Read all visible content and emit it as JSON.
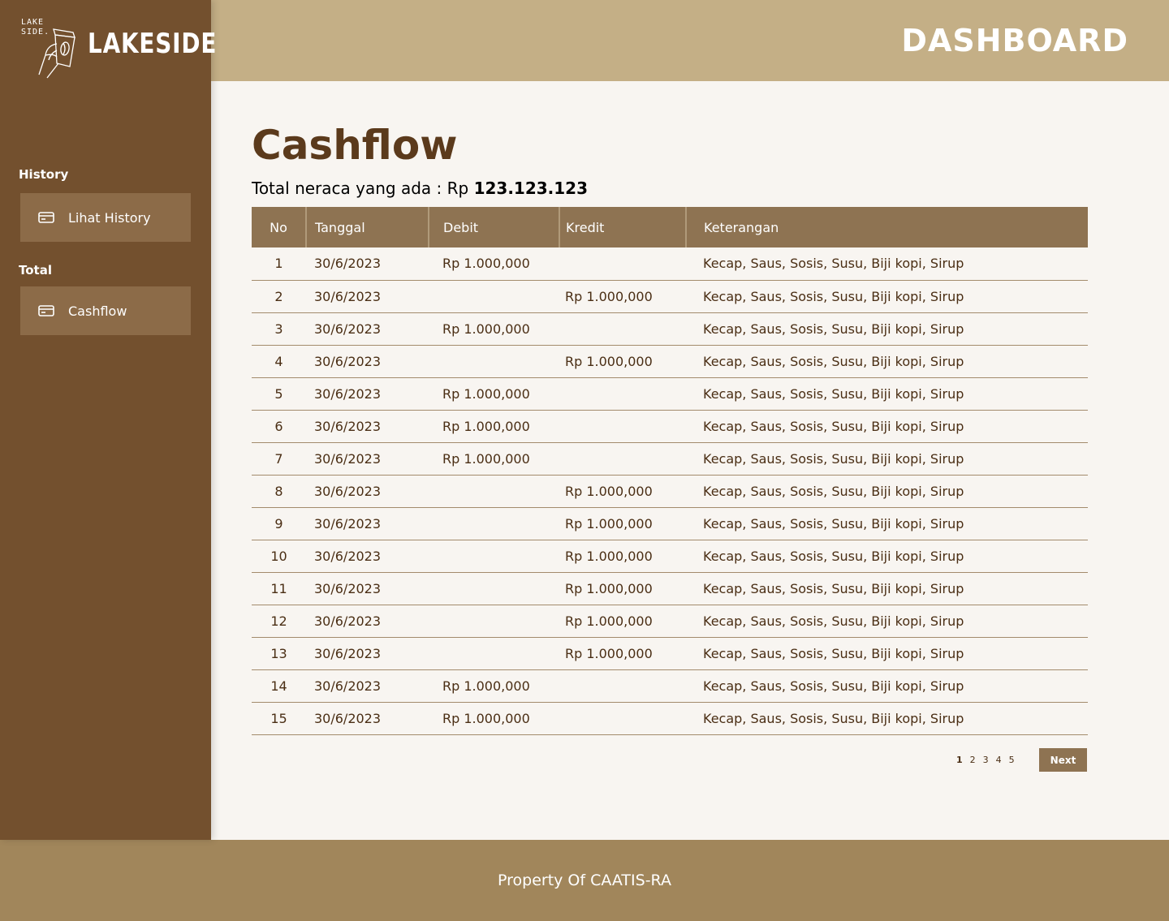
{
  "brand": {
    "small_text": "LAKE\nSIDE.",
    "name": "LAKESIDE"
  },
  "header": {
    "title": "DASHBOARD"
  },
  "sidebar": {
    "sections": [
      {
        "title": "History",
        "button": {
          "label": "Lihat History",
          "icon": "card-icon"
        }
      },
      {
        "title": "Total",
        "button": {
          "label": "Cashflow",
          "icon": "card-icon"
        }
      }
    ]
  },
  "main": {
    "title": "Cashflow",
    "total_label": "Total neraca yang ada : Rp ",
    "total_value": "123.123.123"
  },
  "table": {
    "headers": [
      "No",
      "Tanggal",
      "Debit",
      "Kredit",
      "Keterangan"
    ],
    "rows": [
      {
        "no": "1",
        "tanggal": "30/6/2023",
        "debit": "Rp 1.000,000",
        "kredit": "",
        "keterangan": "Kecap, Saus, Sosis, Susu, Biji kopi, Sirup"
      },
      {
        "no": "2",
        "tanggal": "30/6/2023",
        "debit": "",
        "kredit": "Rp 1.000,000",
        "keterangan": "Kecap, Saus, Sosis, Susu, Biji kopi, Sirup"
      },
      {
        "no": "3",
        "tanggal": "30/6/2023",
        "debit": "Rp 1.000,000",
        "kredit": "",
        "keterangan": "Kecap, Saus, Sosis, Susu, Biji kopi, Sirup"
      },
      {
        "no": "4",
        "tanggal": "30/6/2023",
        "debit": "",
        "kredit": "Rp 1.000,000",
        "keterangan": "Kecap, Saus, Sosis, Susu, Biji kopi, Sirup"
      },
      {
        "no": "5",
        "tanggal": "30/6/2023",
        "debit": "Rp 1.000,000",
        "kredit": "",
        "keterangan": "Kecap, Saus, Sosis, Susu, Biji kopi, Sirup"
      },
      {
        "no": "6",
        "tanggal": "30/6/2023",
        "debit": "Rp 1.000,000",
        "kredit": "",
        "keterangan": "Kecap, Saus, Sosis, Susu, Biji kopi, Sirup"
      },
      {
        "no": "7",
        "tanggal": "30/6/2023",
        "debit": "Rp 1.000,000",
        "kredit": "",
        "keterangan": "Kecap, Saus, Sosis, Susu, Biji kopi, Sirup"
      },
      {
        "no": "8",
        "tanggal": "30/6/2023",
        "debit": "",
        "kredit": "Rp 1.000,000",
        "keterangan": "Kecap, Saus, Sosis, Susu, Biji kopi, Sirup"
      },
      {
        "no": "9",
        "tanggal": "30/6/2023",
        "debit": "",
        "kredit": "Rp 1.000,000",
        "keterangan": "Kecap, Saus, Sosis, Susu, Biji kopi, Sirup"
      },
      {
        "no": "10",
        "tanggal": "30/6/2023",
        "debit": "",
        "kredit": "Rp 1.000,000",
        "keterangan": "Kecap, Saus, Sosis, Susu, Biji kopi, Sirup"
      },
      {
        "no": "11",
        "tanggal": "30/6/2023",
        "debit": "",
        "kredit": "Rp 1.000,000",
        "keterangan": "Kecap, Saus, Sosis, Susu, Biji kopi, Sirup"
      },
      {
        "no": "12",
        "tanggal": "30/6/2023",
        "debit": "",
        "kredit": "Rp 1.000,000",
        "keterangan": "Kecap, Saus, Sosis, Susu, Biji kopi, Sirup"
      },
      {
        "no": "13",
        "tanggal": "30/6/2023",
        "debit": "",
        "kredit": "Rp 1.000,000",
        "keterangan": "Kecap, Saus, Sosis, Susu, Biji kopi, Sirup"
      },
      {
        "no": "14",
        "tanggal": "30/6/2023",
        "debit": "Rp 1.000,000",
        "kredit": "",
        "keterangan": "Kecap, Saus, Sosis, Susu, Biji kopi, Sirup"
      },
      {
        "no": "15",
        "tanggal": "30/6/2023",
        "debit": "Rp 1.000,000",
        "kredit": "",
        "keterangan": "Kecap, Saus, Sosis, Susu, Biji kopi, Sirup"
      }
    ]
  },
  "pagination": {
    "pages": [
      "1",
      "2",
      "3",
      "4",
      "5"
    ],
    "current": "1",
    "next_label": "Next"
  },
  "footer": {
    "text": "Property Of CAATIS-RA"
  },
  "colors": {
    "sidebar": "#73502e",
    "topbar": "#c4af86",
    "table_header": "#8e7352",
    "footer": "#a1865b",
    "button": "#8c6b48"
  }
}
